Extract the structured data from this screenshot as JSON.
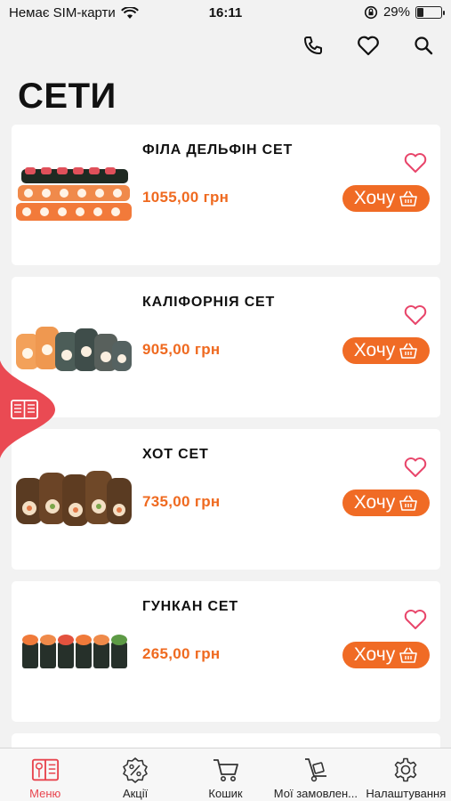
{
  "status": {
    "carrier": "Немає SIM-карти",
    "time": "16:11",
    "battery": "29%",
    "battery_level": 0.29
  },
  "header": {
    "title": "СЕТИ"
  },
  "products": [
    {
      "name": "ФІЛА ДЕЛЬФІН СЕТ",
      "price": "1055,00 грн",
      "button": "Хочу"
    },
    {
      "name": "КАЛІФОРНІЯ СЕТ",
      "price": "905,00 грн",
      "button": "Хочу"
    },
    {
      "name": "ХОТ СЕТ",
      "price": "735,00 грн",
      "button": "Хочу"
    },
    {
      "name": "ГУНКАН СЕТ",
      "price": "265,00 грн",
      "button": "Хочу"
    }
  ],
  "tabs": [
    {
      "label": "Меню",
      "icon": "menu-book-icon",
      "active": true
    },
    {
      "label": "Акції",
      "icon": "percent-badge-icon"
    },
    {
      "label": "Кошик",
      "icon": "cart-icon"
    },
    {
      "label": "Мої замовлен...",
      "icon": "dolly-icon"
    },
    {
      "label": "Налаштування",
      "icon": "gear-icon"
    }
  ],
  "colors": {
    "accent": "#f06b25",
    "active_tab": "#e8454f",
    "heart": "#e8456a",
    "side_tab": "#ea4a53"
  }
}
